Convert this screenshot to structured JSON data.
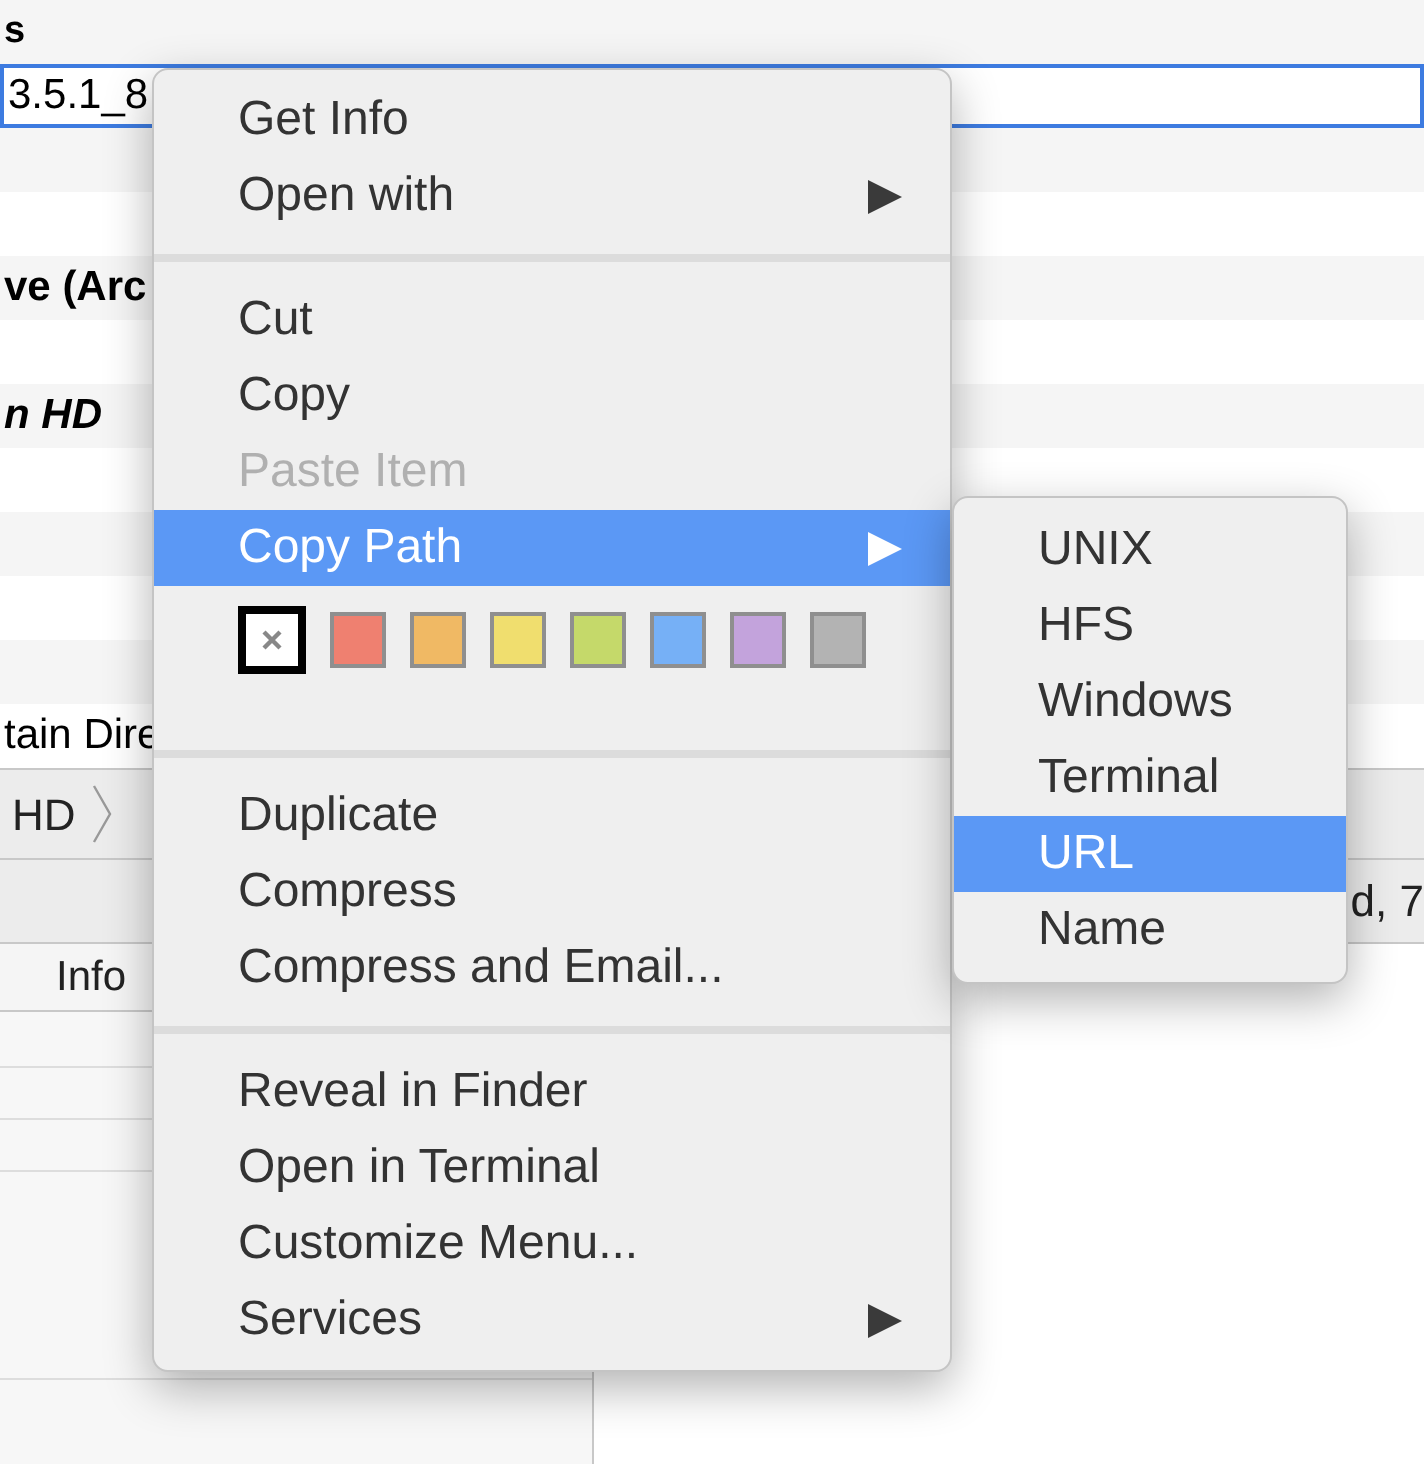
{
  "list_header": "s",
  "list_rows": [
    {
      "text": "3.5.1_8",
      "selected": true,
      "bold": false,
      "italic": false
    },
    {
      "selected": false
    },
    {
      "selected": false
    },
    {
      "text": "ve (Arc",
      "selected": false,
      "bold": true,
      "italic": false
    },
    {
      "selected": false
    },
    {
      "text": "n HD",
      "selected": false,
      "bold": true,
      "italic": true
    },
    {
      "selected": false
    },
    {
      "selected": false
    },
    {
      "selected": false
    },
    {
      "selected": false
    },
    {
      "text": "tain Dire",
      "selected": false,
      "bold": false,
      "italic": false
    }
  ],
  "path_bar": [
    {
      "label": "HD",
      "chevron": true
    }
  ],
  "status_text": "d, 7",
  "column_header": "Info",
  "context_menu": [
    {
      "kind": "item",
      "label": "Get Info",
      "disabled": false,
      "selected": false,
      "submenu": false
    },
    {
      "kind": "item",
      "label": "Open with",
      "disabled": false,
      "selected": false,
      "submenu": true
    },
    {
      "kind": "separator"
    },
    {
      "kind": "item",
      "label": "Cut",
      "disabled": false,
      "selected": false,
      "submenu": false
    },
    {
      "kind": "item",
      "label": "Copy",
      "disabled": false,
      "selected": false,
      "submenu": false
    },
    {
      "kind": "item",
      "label": "Paste Item",
      "disabled": true,
      "selected": false,
      "submenu": false
    },
    {
      "kind": "item",
      "label": "Copy Path",
      "disabled": false,
      "selected": true,
      "submenu": true
    },
    {
      "kind": "colors",
      "swatches": [
        {
          "kind": "none",
          "selected": true
        },
        {
          "color": "#ef8070",
          "selected": false
        },
        {
          "color": "#f0b964",
          "selected": false
        },
        {
          "color": "#f0de6e",
          "selected": false
        },
        {
          "color": "#c5d96a",
          "selected": false
        },
        {
          "color": "#76b0f6",
          "selected": false
        },
        {
          "color": "#c3a3dc",
          "selected": false
        },
        {
          "color": "#b3b3b3",
          "selected": false
        }
      ]
    },
    {
      "kind": "separator"
    },
    {
      "kind": "item",
      "label": "Duplicate",
      "disabled": false,
      "selected": false,
      "submenu": false
    },
    {
      "kind": "item",
      "label": "Compress",
      "disabled": false,
      "selected": false,
      "submenu": false
    },
    {
      "kind": "item",
      "label": "Compress and Email...",
      "disabled": false,
      "selected": false,
      "submenu": false
    },
    {
      "kind": "separator"
    },
    {
      "kind": "item",
      "label": "Reveal in Finder",
      "disabled": false,
      "selected": false,
      "submenu": false
    },
    {
      "kind": "item",
      "label": "Open in Terminal",
      "disabled": false,
      "selected": false,
      "submenu": false
    },
    {
      "kind": "item",
      "label": "Customize Menu...",
      "disabled": false,
      "selected": false,
      "submenu": false
    },
    {
      "kind": "item",
      "label": "Services",
      "disabled": false,
      "selected": false,
      "submenu": true
    }
  ],
  "submenu": [
    {
      "label": "UNIX",
      "selected": false
    },
    {
      "label": "HFS",
      "selected": false
    },
    {
      "label": "Windows",
      "selected": false
    },
    {
      "label": "Terminal",
      "selected": false
    },
    {
      "label": "URL",
      "selected": true
    },
    {
      "label": "Name",
      "selected": false
    }
  ]
}
